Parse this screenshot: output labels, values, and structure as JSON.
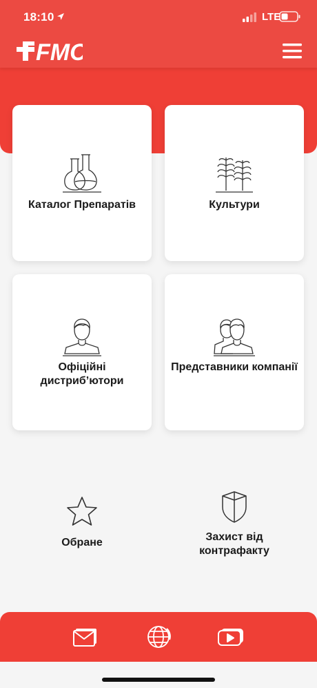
{
  "status_bar": {
    "time": "18:10",
    "network": "LTE"
  },
  "header": {
    "logo_text": "FMC",
    "menu_icon": "hamburger-menu-icon"
  },
  "grid": [
    {
      "label": "Каталог Препаратів",
      "icon": "flasks-icon"
    },
    {
      "label": "Культури",
      "icon": "crops-icon"
    },
    {
      "label": "Офіційні дистриб’ютори",
      "icon": "person-icon"
    },
    {
      "label": "Представники компанії",
      "icon": "people-icon"
    }
  ],
  "extras": [
    {
      "label": "Обране",
      "icon": "star-icon"
    },
    {
      "label": "Захист від контрафакту",
      "icon": "shield-icon"
    }
  ],
  "bottom_bar": [
    {
      "icon": "mail-icon"
    },
    {
      "icon": "globe-icon"
    },
    {
      "icon": "youtube-icon"
    }
  ],
  "colors": {
    "brand_red": "#ef3f36",
    "background": "#f5f5f5",
    "card": "#ffffff"
  }
}
